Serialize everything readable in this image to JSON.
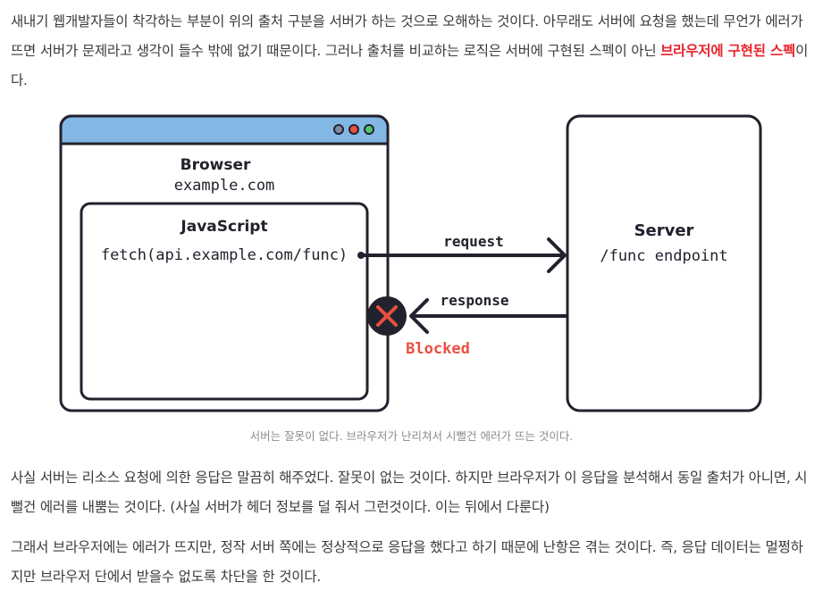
{
  "paragraphs": {
    "p1_before": "새내기 웹개발자들이 착각하는 부분이 위의 출처 구분을 서버가 하는 것으로 오해하는 것이다. 아무래도 서버에 요청을 했는데 무언가 에러가 뜨면 서버가 문제라고 생각이 들수 밖에 없기 때문이다. 그러나 출처를 비교하는 로직은 서버에 구현된 스펙이 아닌 ",
    "p1_highlight": "브라우저에 구현된 스펙",
    "p1_after": "이다.",
    "p2": "사실 서버는 리소스 요청에 의한 응답은 말끔히 해주었다. 잘못이 없는 것이다. 하지만 브라우저가 이 응답을 분석해서 동일 출처가 아니면, 시뻘건 에러를 내뿜는 것이다. (사실 서버가 헤더 정보를 덜 줘서 그런것이다. 이는 뒤에서 다룬다)",
    "p3": "그래서 브라우저에는 에러가 뜨지만, 정작 서버 쪽에는 정상적으로 응답을 했다고 하기 때문에 난항은 겪는 것이다. 즉, 응답 데이터는 멀쩡하지만 브라우저 단에서 받을수 없도록 차단을 한 것이다."
  },
  "diagram": {
    "browser_title": "Browser",
    "browser_origin": "example.com",
    "js_title": "JavaScript",
    "js_code": "fetch(api.example.com/func)",
    "request_label": "request",
    "response_label": "response",
    "blocked_label": "Blocked",
    "server_title": "Server",
    "server_endpoint": "/func endpoint",
    "colors": {
      "titlebar": "#83b8e5",
      "outline": "#22222e",
      "blocked": "#e8503f",
      "dot_gray": "#7f8aa3",
      "dot_red": "#e8503f",
      "dot_green": "#55c26b"
    }
  },
  "caption": "서버는 잘못이 없다. 브라우저가 난리쳐서 시뻘건 에러가 뜨는 것이다."
}
